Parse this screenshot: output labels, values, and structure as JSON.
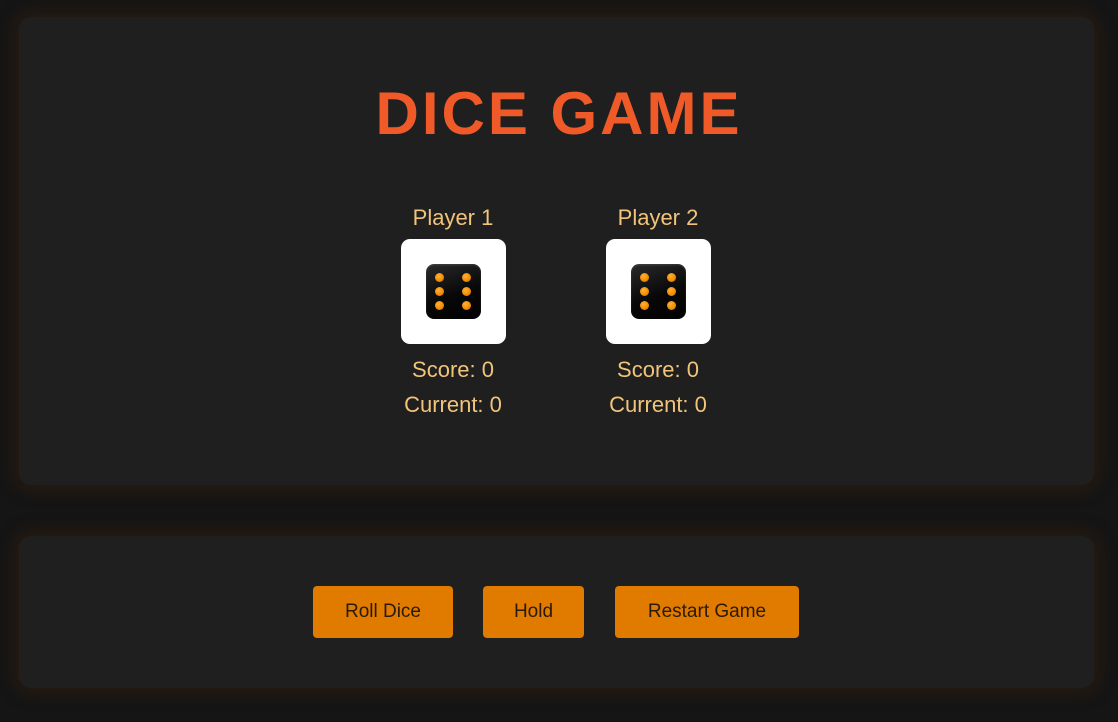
{
  "title": "DICE GAME",
  "colors": {
    "title": "#f05a28",
    "text": "#f2c47a",
    "button": "#e07b00",
    "button_text": "#2a1a08",
    "panel": "#1f1f1f",
    "background": "#151515"
  },
  "players": [
    {
      "name": "Player 1",
      "score_text": "Score: 0",
      "current_text": "Current: 0",
      "score": 0,
      "current": 0,
      "die_value": 6,
      "die_icon": "dice-six-icon"
    },
    {
      "name": "Player 2",
      "score_text": "Score: 0",
      "current_text": "Current: 0",
      "score": 0,
      "current": 0,
      "die_value": 6,
      "die_icon": "dice-six-icon"
    }
  ],
  "controls": {
    "roll_label": "Roll Dice",
    "hold_label": "Hold",
    "restart_label": "Restart Game"
  }
}
